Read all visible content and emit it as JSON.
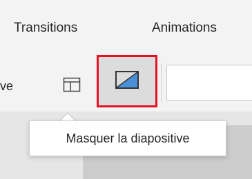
{
  "ribbon": {
    "tabs": [
      {
        "label": "Transitions"
      },
      {
        "label": "Animations"
      }
    ],
    "toolbar": {
      "partial_label": "ve",
      "layout_icon": "slide-layout-icon",
      "hide_slide_icon": "hide-slide-icon",
      "highlight_color": "#e81123"
    }
  },
  "tooltip": {
    "text": "Masquer la diapositive"
  }
}
